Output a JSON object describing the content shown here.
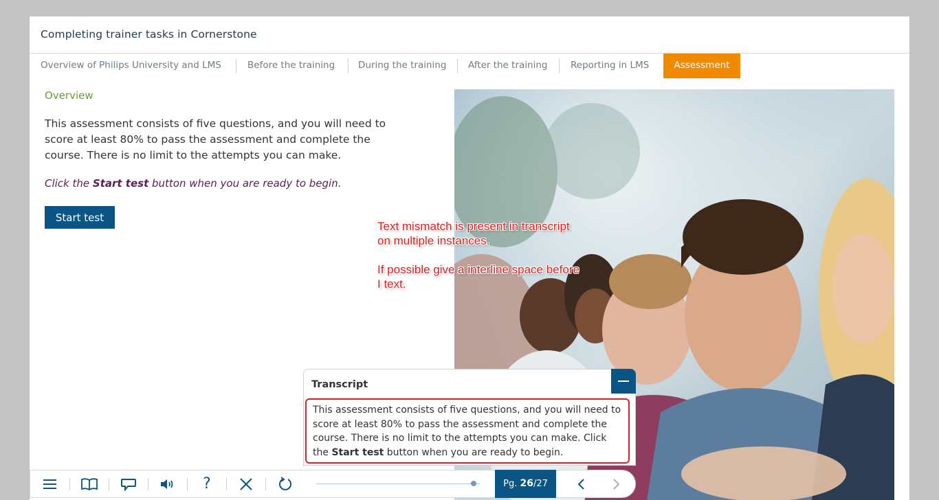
{
  "course": {
    "title": "Completing trainer tasks in Cornerstone"
  },
  "tabs": [
    {
      "label": "Overview of Philips University and LMS"
    },
    {
      "label": "Before the training"
    },
    {
      "label": "During the training"
    },
    {
      "label": "After the training"
    },
    {
      "label": "Reporting in LMS"
    },
    {
      "label": "Assessment",
      "active": true
    }
  ],
  "content": {
    "heading": "Overview",
    "intro": "This assessment consists of five questions, and you will need to score at least 80% to pass the assessment and complete the course. There is no limit to the attempts you can make.",
    "instruction_pre": "Click the ",
    "instruction_bold": "Start test",
    "instruction_post": " button when you are ready to begin.",
    "start_button": "Start test"
  },
  "annotation": {
    "line1": "Text mismatch is present in transcript on multiple instances.",
    "line2": "If possible give a interline space before I text."
  },
  "transcript": {
    "title": "Transcript",
    "body": "This assessment consists of five questions, and you will need to score at least 80% to pass the assessment and complete the course. There is no limit to the attempts you can make. Click the ",
    "bold": "Start test",
    "body_end": " button when you are ready to begin."
  },
  "toolbar": {
    "icons": [
      "menu-icon",
      "book-icon",
      "chat-icon",
      "audio-icon",
      "help-icon",
      "close-icon",
      "refresh-icon"
    ],
    "help_glyph": "?",
    "page_prefix": "Pg. ",
    "page_current": "26",
    "page_total": "/27",
    "progress": 0.963
  },
  "colors": {
    "accent_orange": "#f08a00",
    "primary_blue": "#0a5583",
    "heading_green": "#6a9a3a",
    "instruction_purple": "#5b1e52",
    "annotation_red": "#e41b1b"
  }
}
